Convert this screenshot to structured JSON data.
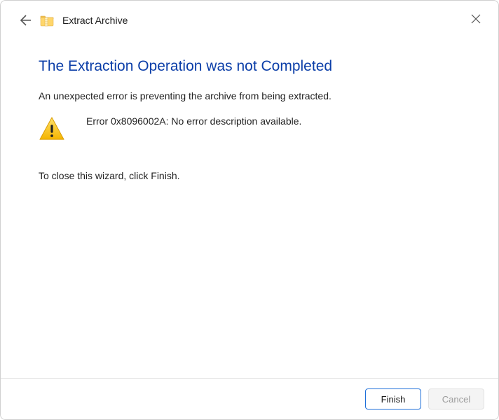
{
  "window": {
    "title": "Extract Archive"
  },
  "content": {
    "heading": "The Extraction Operation was not Completed",
    "summary": "An unexpected error is preventing the archive from being extracted.",
    "error_message": "Error 0x8096002A: No error description available.",
    "instruction": "To close this wizard, click Finish."
  },
  "footer": {
    "finish_label": "Finish",
    "cancel_label": "Cancel"
  }
}
